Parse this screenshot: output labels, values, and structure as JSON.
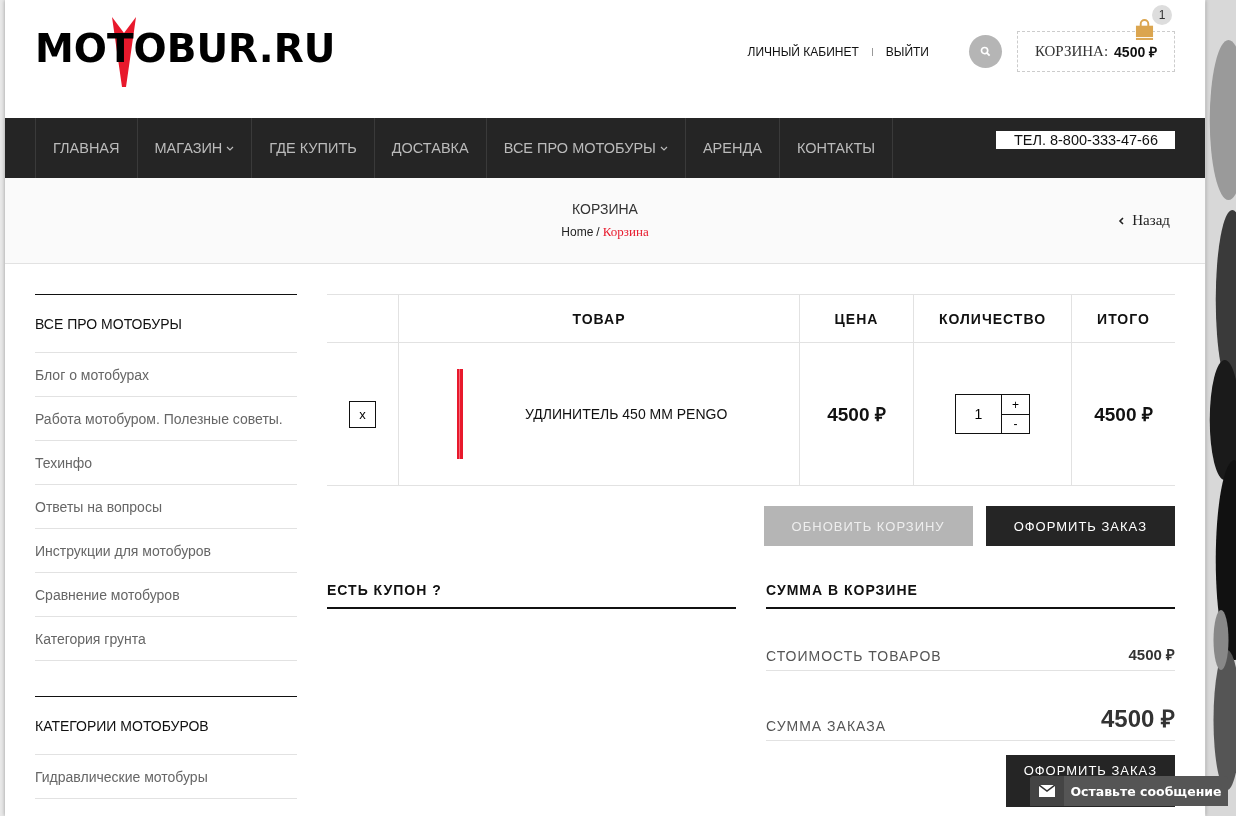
{
  "header": {
    "logo": "MOTOBUR.RU",
    "account_links": [
      "ЛИЧНЫЙ КАБИНЕТ",
      "ВЫЙТИ"
    ],
    "cart": {
      "label": "КОРЗИНА:",
      "total": "4500 ₽",
      "count": "1"
    }
  },
  "nav": {
    "items": [
      {
        "label": "ГЛАВНАЯ",
        "dropdown": false
      },
      {
        "label": "МАГАЗИН",
        "dropdown": true
      },
      {
        "label": "ГДЕ КУПИТЬ",
        "dropdown": false
      },
      {
        "label": "ДОСТАВКА",
        "dropdown": false
      },
      {
        "label": "ВСЕ ПРО МОТОБУРЫ",
        "dropdown": true
      },
      {
        "label": "АРЕНДА",
        "dropdown": false
      },
      {
        "label": "КОНТАКТЫ",
        "dropdown": false
      }
    ],
    "phone": "ТЕЛ. 8-800-333-47-66"
  },
  "page_header": {
    "title": "КОРЗИНА",
    "breadcrumb": [
      {
        "label": "Home",
        "current": false
      },
      {
        "label": "Корзина",
        "current": true
      }
    ],
    "separator": "/",
    "back": "Назад"
  },
  "sidebar": {
    "sections": [
      {
        "title": "ВСЕ ПРО МОТОБУРЫ",
        "items": [
          "Блог о мотобурах",
          "Работа мотобуром. Полезные советы.",
          "Техинфо",
          "Ответы на вопросы",
          "Инструкции для мотобуров",
          "Сравнение мотобуров",
          "Категория грунта"
        ]
      },
      {
        "title": "КАТЕГОРИИ МОТОБУРОВ",
        "items": [
          "Гидравлические мотобуры"
        ]
      }
    ]
  },
  "cart_table": {
    "columns": [
      "ТОВАР",
      "ЦЕНА",
      "КОЛИЧЕСТВО",
      "ИТОГО"
    ],
    "rows": [
      {
        "remove": "x",
        "product": "УДЛИНИТЕЛЬ 450 ММ PENGO",
        "price": "4500 ₽",
        "quantity": "1",
        "increment": "+",
        "decrement": "-",
        "total": "4500 ₽"
      }
    ]
  },
  "actions": [
    {
      "label": "ОБНОВИТЬ КОРЗИНУ",
      "disabled": true
    },
    {
      "label": "ОФОРМИТЬ ЗАКАЗ",
      "disabled": false
    }
  ],
  "coupon": {
    "title": "ЕСТЬ КУПОН ?"
  },
  "totals": {
    "title": "СУММА В КОРЗИНЕ",
    "rows": [
      {
        "label": "СТОИМОСТЬ ТОВАРОВ",
        "value": "4500 ₽",
        "emphasis": false
      },
      {
        "label": "СУММА ЗАКАЗА",
        "value": "4500 ₽",
        "emphasis": true
      }
    ],
    "button": "ОФОРМИТЬ ЗАКАЗ"
  },
  "chat_widget": {
    "label": "Оставьте сообщение"
  }
}
